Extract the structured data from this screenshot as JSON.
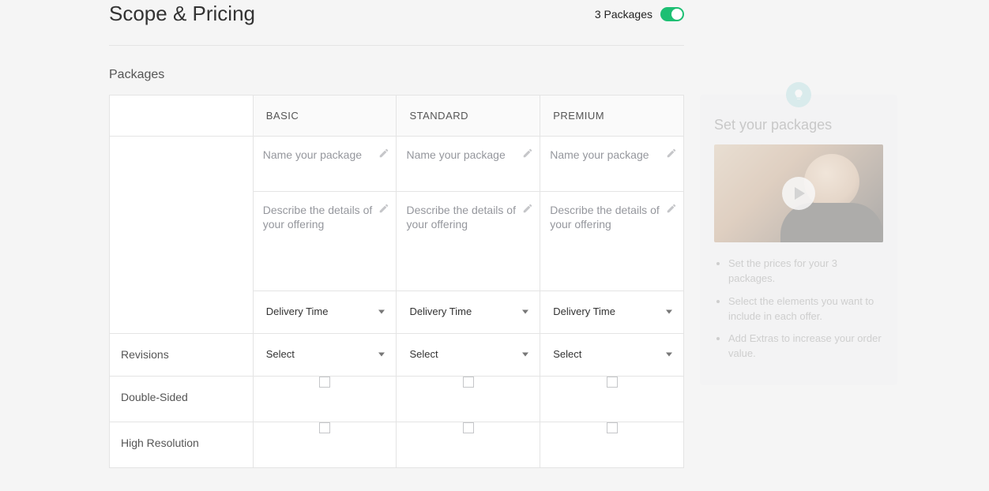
{
  "header": {
    "title": "Scope & Pricing",
    "toggle_label": "3 Packages"
  },
  "section_label": "Packages",
  "columns": {
    "basic": "BASIC",
    "standard": "STANDARD",
    "premium": "PREMIUM"
  },
  "placeholders": {
    "name": "Name your package",
    "describe": "Describe the details of your offering",
    "delivery": "Delivery Time",
    "select": "Select"
  },
  "rows": {
    "revisions": "Revisions",
    "double_sided": "Double-Sided",
    "high_resolution": "High Resolution"
  },
  "sidebar": {
    "title": "Set your packages",
    "tips": [
      "Set the prices for your 3 packages.",
      "Select the elements you want to include in each offer.",
      "Add Extras to increase your order value."
    ]
  }
}
